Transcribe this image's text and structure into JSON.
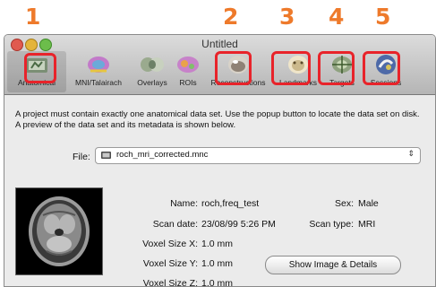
{
  "callouts": [
    "1",
    "2",
    "3",
    "4",
    "5"
  ],
  "window": {
    "title": "Untitled"
  },
  "toolbar": {
    "items": [
      {
        "label": "Anatomical",
        "icon": "anatomical-icon"
      },
      {
        "label": "MNI/Talairach",
        "icon": "mni-talairach-icon"
      },
      {
        "label": "Overlays",
        "icon": "overlays-icon"
      },
      {
        "label": "ROIs",
        "icon": "rois-icon"
      },
      {
        "label": "Reconstructions",
        "icon": "reconstructions-icon"
      },
      {
        "label": "Landmarks",
        "icon": "landmarks-icon"
      },
      {
        "label": "Targets",
        "icon": "targets-icon"
      },
      {
        "label": "Sessions",
        "icon": "sessions-icon"
      }
    ],
    "selected": "Anatomical"
  },
  "description": "A project must contain exactly one anatomical data set. Use the popup button to locate the data set on disk. A preview of the data set and its metadata is shown below.",
  "file": {
    "label": "File:",
    "value": "roch_mri_corrected.mnc"
  },
  "metadata": {
    "name_label": "Name:",
    "name": "roch,freq_test",
    "sex_label": "Sex:",
    "sex": "Male",
    "scan_date_label": "Scan date:",
    "scan_date": "23/08/99 5:26 PM",
    "scan_type_label": "Scan type:",
    "scan_type": "MRI",
    "voxel_x_label": "Voxel Size X:",
    "voxel_x": "1.0 mm",
    "voxel_y_label": "Voxel Size Y:",
    "voxel_y": "1.0 mm",
    "voxel_z_label": "Voxel Size Z:",
    "voxel_z": "1.0 mm"
  },
  "show_button": "Show Image & Details",
  "colors": {
    "callout": "#ee7a2b",
    "highlight": "#e8232a"
  }
}
